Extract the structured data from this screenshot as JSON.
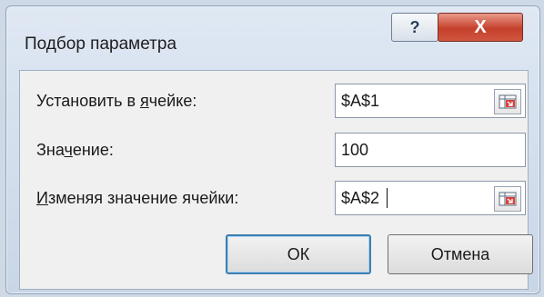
{
  "window": {
    "title": "Подбор параметра"
  },
  "titlebar": {
    "help_label": "?",
    "close_label": "X"
  },
  "form": {
    "set_cell": {
      "label_pre": "Установить в ",
      "label_ul": "я",
      "label_post": "чейке:",
      "value": "$A$1"
    },
    "value": {
      "label_pre": "Зна",
      "label_ul": "ч",
      "label_post": "ение:",
      "value": "100"
    },
    "changing_cell": {
      "label_pre": "",
      "label_ul": "И",
      "label_post": "зменяя значение ячейки:",
      "value": "$A$2"
    }
  },
  "buttons": {
    "ok_label": "ОК",
    "cancel_label": "Отмена"
  },
  "icons": {
    "ref_icon": "range-select-icon",
    "help_icon": "help-icon",
    "close_icon": "close-icon"
  },
  "colors": {
    "close_button": "#c4402b",
    "default_button_border": "#3c7fb1"
  }
}
